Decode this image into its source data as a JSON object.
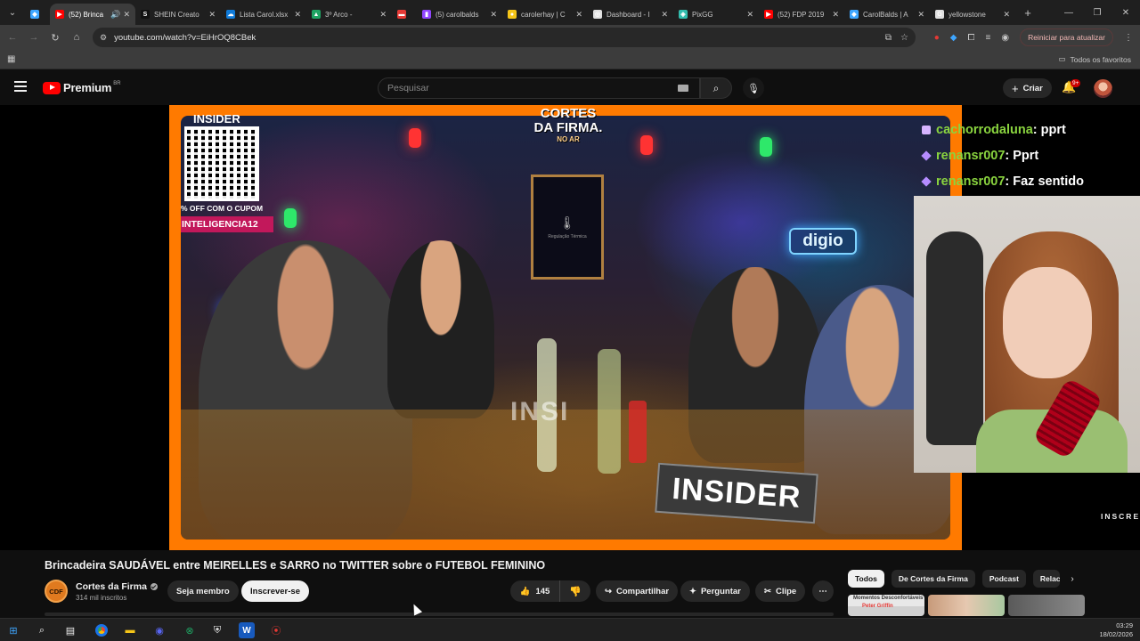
{
  "browser": {
    "tabs": [
      {
        "title": "",
        "color": "#3ea6ff",
        "glyph": "◆"
      },
      {
        "title": "(52) Brinca",
        "color": "#ff0000",
        "glyph": "▶",
        "active": true
      },
      {
        "title": "SHEIN Creato",
        "color": "#111111",
        "glyph": "S"
      },
      {
        "title": "Lista Carol.xlsx",
        "color": "#0f7ad8",
        "glyph": "☁"
      },
      {
        "title": "3º Arco -",
        "color": "#1fa463",
        "glyph": "▲"
      },
      {
        "title": "",
        "color": "#e53935",
        "glyph": "▬"
      },
      {
        "title": "(5) carolbalds",
        "color": "#9146ff",
        "glyph": "▮"
      },
      {
        "title": "carolerhay | C",
        "color": "#f5c518",
        "glyph": "●"
      },
      {
        "title": "Dashboard - I",
        "color": "#e0e0e0",
        "glyph": "◎"
      },
      {
        "title": "PixGG",
        "color": "#32bcad",
        "glyph": "◈"
      },
      {
        "title": "(52) FDP 2019",
        "color": "#ff0000",
        "glyph": "▶"
      },
      {
        "title": "CarolBalds | A",
        "color": "#3ea6ff",
        "glyph": "◆"
      },
      {
        "title": "yellowstone",
        "color": "#e0e0e0",
        "glyph": "G"
      }
    ],
    "url": "youtube.com/watch?v=EiHrOQ8CBek",
    "restart_label": "Reiniciar para atualizar",
    "bookmarks_all": "Todos os favoritos"
  },
  "youtube": {
    "brand": "Premium",
    "country": "BR",
    "search_placeholder": "Pesquisar",
    "create_label": "Criar",
    "notifications": "9+"
  },
  "video": {
    "qr_top": "INSIDER",
    "promo_off": "% OFF COM O CUPOM",
    "promo_coupon": "INTELIGENCIA12",
    "show_logo_line1": "CORTES",
    "show_logo_line2": "DA FIRMA.",
    "show_logo_line3": "NO AR",
    "screen_label": "Regulação Térmica",
    "sponsor": "digio",
    "sign": "INSIDER",
    "glass_text": "INSI",
    "subscribe_watermark": "INSCREVER",
    "chat": [
      {
        "user": "cachorrodaluna",
        "msg": " : pprt",
        "user_color": "#8ad43f"
      },
      {
        "user": "renansr007",
        "msg": " : Pprt",
        "user_color": "#8ad43f"
      },
      {
        "user": "renansr007",
        "msg": " : Faz sentido",
        "user_color": "#8ad43f"
      }
    ]
  },
  "watch": {
    "title": "Brincadeira SAUDÁVEL entre MEIRELLES e SARRO no TWITTER sobre o FUTEBOL FEMININO",
    "channel_initials": "CDF",
    "channel": "Cortes da Firma",
    "subscribers": "314 mil inscritos",
    "join_label": "Seja membro",
    "subscribe_label": "Inscrever-se",
    "likes": "145",
    "share_label": "Compartilhar",
    "ask_label": "Perguntar",
    "clip_label": "Clipe",
    "chips": [
      "Todos",
      "De Cortes da Firma",
      "Podcast",
      "Relacionados"
    ],
    "thumb1_line1": "Momentos Desconfortáveis",
    "thumb1_line2": "Peter Griffin"
  },
  "system": {
    "time": "03:29",
    "date": "18/02/2026"
  }
}
